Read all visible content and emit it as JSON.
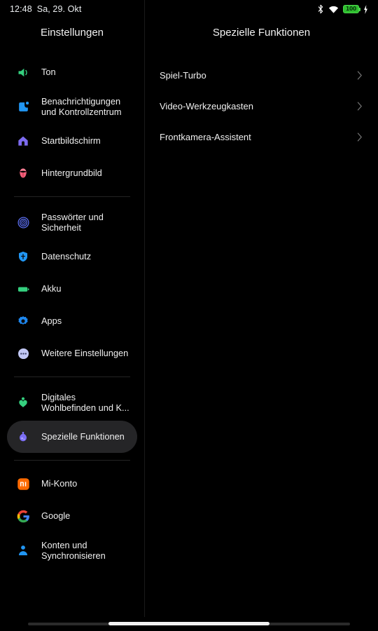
{
  "statusbar": {
    "time": "12:48",
    "date": "Sa, 29. Okt",
    "bluetooth_icon": "bluetooth-icon",
    "wifi_icon": "wifi-icon",
    "battery_level": "100",
    "charging_icon": "charging-bolt-icon"
  },
  "sidebar": {
    "title": "Einstellungen",
    "items": [
      {
        "label": "Ton",
        "icon": "speaker-icon",
        "color": "#35d07f",
        "selected": false
      },
      {
        "label": "Benachrichtigungen\nund Kontrollzentrum",
        "icon": "notification-badge-icon",
        "color": "#2196f3",
        "selected": false
      },
      {
        "label": "Startbildschirm",
        "icon": "home-icon",
        "color": "#7d6bf0",
        "selected": false
      },
      {
        "label": "Hintergrundbild",
        "icon": "flower-icon",
        "color": "#f2607a",
        "selected": false
      },
      {
        "label": "Passwörter und\nSicherheit",
        "icon": "fingerprint-icon",
        "color": "#5b6ef0",
        "selected": false
      },
      {
        "label": "Datenschutz",
        "icon": "shield-icon",
        "color": "#2196f3",
        "selected": false
      },
      {
        "label": "Akku",
        "icon": "battery-icon",
        "color": "#35d07f",
        "selected": false
      },
      {
        "label": "Apps",
        "icon": "gear-icon",
        "color": "#1e88f0",
        "selected": false
      },
      {
        "label": "Weitere Einstellungen",
        "icon": "more-dots-icon",
        "color": "#c2c8f5",
        "selected": false
      },
      {
        "label": "Digitales\nWohlbefinden und K...",
        "icon": "heart-person-icon",
        "color": "#35d07f",
        "selected": false
      },
      {
        "label": "Spezielle Funktionen",
        "icon": "potion-icon",
        "color": "#7b6ef5",
        "selected": true
      },
      {
        "label": "Mi-Konto",
        "icon": "mi-logo-icon",
        "color": "#ff6a00",
        "selected": false
      },
      {
        "label": "Google",
        "icon": "google-logo-icon",
        "color": "#4285f4",
        "selected": false
      },
      {
        "label": "Konten und\nSynchronisieren",
        "icon": "person-icon",
        "color": "#2196f3",
        "selected": false
      }
    ]
  },
  "content": {
    "title": "Spezielle Funktionen",
    "rows": [
      {
        "label": "Spiel-Turbo",
        "chevron": "chevron-right-icon"
      },
      {
        "label": "Video-Werkzeugkasten",
        "chevron": "chevron-right-icon"
      },
      {
        "label": "Frontkamera-Assistent",
        "chevron": "chevron-right-icon"
      }
    ]
  },
  "gesture_bar": {
    "name": "navigation-gesture-bar"
  },
  "colors": {
    "background": "#000000",
    "selected_pill": "#252527",
    "divider": "#232323",
    "text_primary": "#f0f0f0"
  }
}
